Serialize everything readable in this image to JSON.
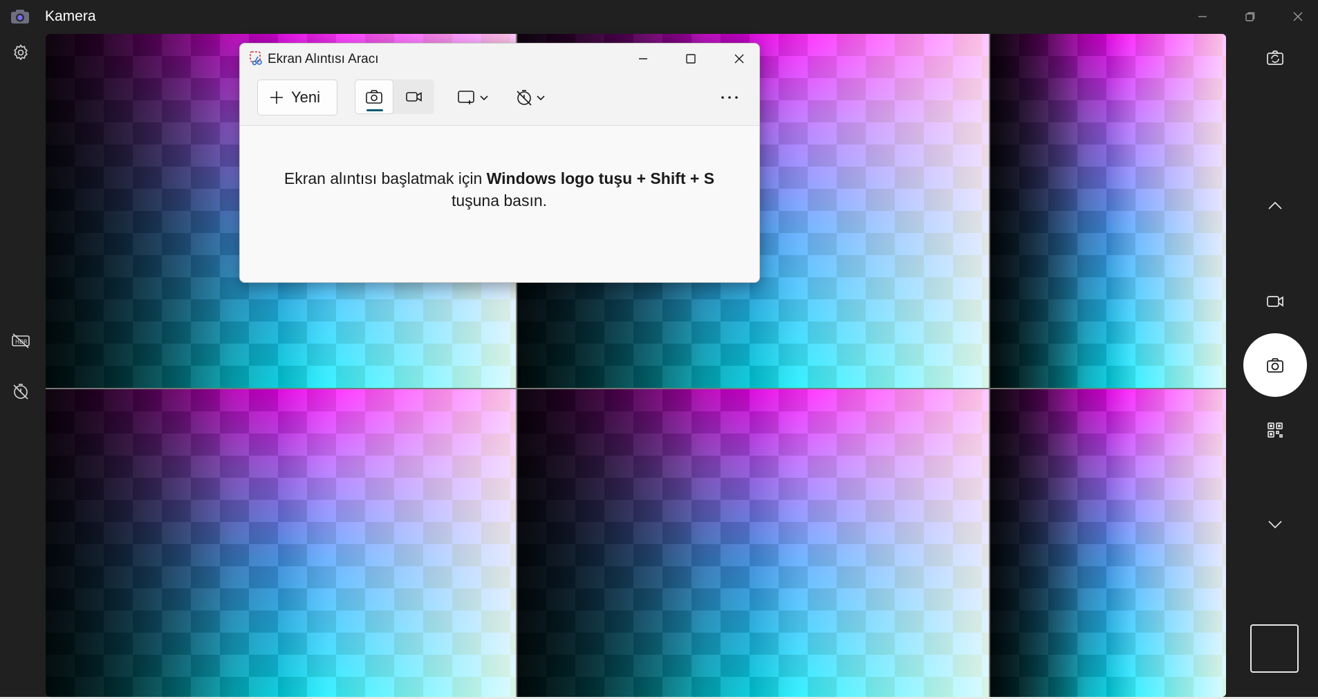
{
  "app": {
    "title": "Kamera",
    "icon": "camera-app-icon"
  },
  "window_controls": [
    "minimize-icon",
    "restore-icon",
    "close-icon"
  ],
  "left_rail": [
    "gear-icon",
    "hdr-off-icon",
    "timer-off-icon"
  ],
  "right_rail": [
    "switch-camera-icon",
    "chevron-up-icon",
    "video-mode-icon",
    "photo-capture-icon",
    "qr-code-icon",
    "chevron-down-icon"
  ],
  "snipping_tool": {
    "title": "Ekran Alıntısı Aracı",
    "new_label": "Yeni",
    "active_mode": "photo",
    "hint_prefix": "Ekran alıntısı başlatmak için ",
    "hint_bold": "Windows logo tuşu + Shift + S",
    "hint_suffix": " tuşuna basın."
  },
  "colors": {
    "background": "#202020",
    "dialog": "#f9f9f9",
    "accent": "#005a70"
  }
}
